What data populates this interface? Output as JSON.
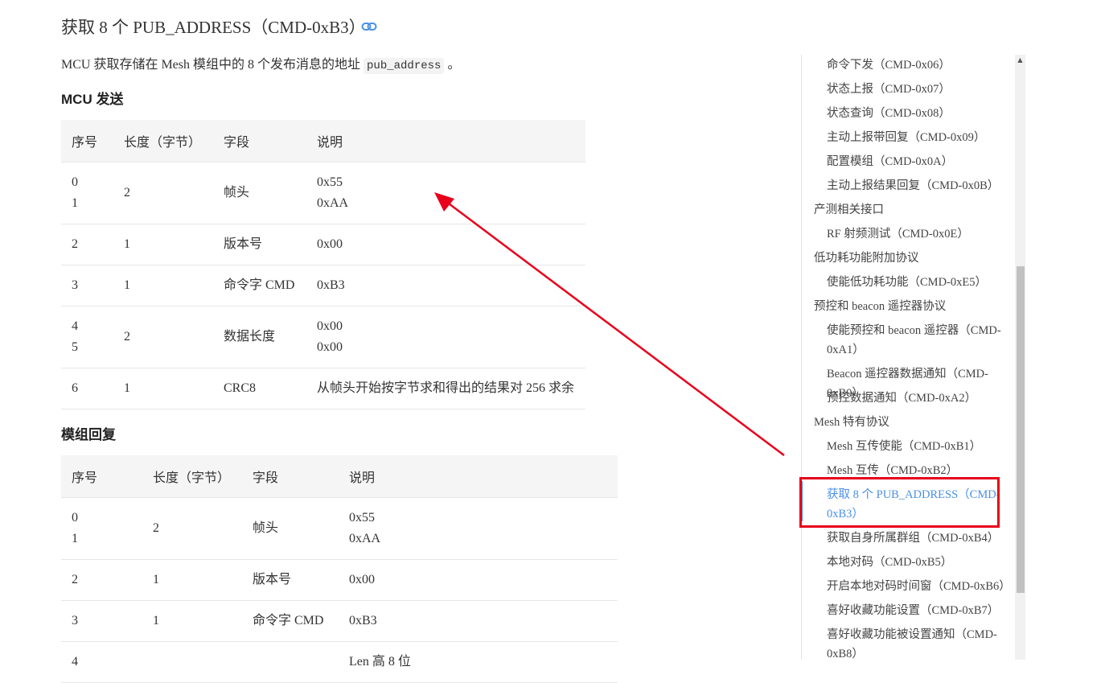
{
  "page": {
    "title": "获取 8 个 PUB_ADDRESS（CMD-0xB3）",
    "intro_before": "MCU 获取存储在 Mesh 模组中的 8 个发布消息的地址",
    "intro_code": "pub_address",
    "intro_after": "。"
  },
  "send_section": {
    "heading": "MCU 发送",
    "headers": [
      "序号",
      "长度（字节）",
      "字段",
      "说明"
    ],
    "rows": [
      {
        "seq": "0\n1",
        "len": "2",
        "field": "帧头",
        "desc": "0x55\n0xAA"
      },
      {
        "seq": "2",
        "len": "1",
        "field": "版本号",
        "desc": "0x00"
      },
      {
        "seq": "3",
        "len": "1",
        "field": "命令字 CMD",
        "desc": "0xB3"
      },
      {
        "seq": "4\n5",
        "len": "2",
        "field": "数据长度",
        "desc": "0x00\n0x00"
      },
      {
        "seq": "6",
        "len": "1",
        "field": "CRC8",
        "desc": "从帧头开始按字节求和得出的结果对 256 求余"
      }
    ]
  },
  "reply_section": {
    "heading": "模组回复",
    "headers": [
      "序号",
      "长度（字节）",
      "字段",
      "说明"
    ],
    "rows": [
      {
        "seq": "0\n1",
        "len": "2",
        "field": "帧头",
        "desc": "0x55\n0xAA"
      },
      {
        "seq": "2",
        "len": "1",
        "field": "版本号",
        "desc": "0x00"
      },
      {
        "seq": "3",
        "len": "1",
        "field": "命令字 CMD",
        "desc": "0xB3"
      },
      {
        "seq": "4",
        "len": "",
        "field": "",
        "desc": "Len 高 8 位"
      }
    ]
  },
  "toc": {
    "items": [
      {
        "label": "命令下发（CMD-0x06）"
      },
      {
        "label": "状态上报（CMD-0x07）"
      },
      {
        "label": "状态查询（CMD-0x08）"
      },
      {
        "label": "主动上报带回复（CMD-0x09）"
      },
      {
        "label": "配置模组（CMD-0x0A）"
      },
      {
        "label": "主动上报结果回复（CMD-0x0B）"
      },
      {
        "label": "产测相关接口"
      },
      {
        "label": "RF 射频测试（CMD-0x0E）"
      },
      {
        "label": "低功耗功能附加协议"
      },
      {
        "label": "使能低功耗功能（CMD-0xE5）"
      },
      {
        "label": "预控和 beacon 遥控器协议"
      },
      {
        "label": "使能预控和 beacon 遥控器（CMD-0xA1）"
      },
      {
        "label": "Beacon 遥控器数据通知（CMD-0xB0）"
      },
      {
        "label": "预控数据通知（CMD-0xA2）"
      },
      {
        "label": "Mesh 特有协议"
      },
      {
        "label": "Mesh 互传使能（CMD-0xB1）"
      },
      {
        "label": "Mesh 互传（CMD-0xB2）"
      },
      {
        "label": "获取 8 个 PUB_ADDRESS（CMD-0xB3）"
      },
      {
        "label": "获取自身所属群组（CMD-0xB4）"
      },
      {
        "label": "本地对码（CMD-0xB5）"
      },
      {
        "label": "开启本地对码时间窗（CMD-0xB6）"
      },
      {
        "label": "喜好收藏功能设置（CMD-0xB7）"
      },
      {
        "label": "喜好收藏功能被设置通知（CMD-0xB8）"
      }
    ],
    "active_label": "获取 8 个 PUB_ADDRESS（CMD-0xB3）"
  },
  "colors": {
    "active": "#4a8fe7",
    "annotation": "#e8001c"
  },
  "icons": {
    "title_anchor": "link-icon",
    "scroll_up": "scroll-up-arrow-icon"
  }
}
